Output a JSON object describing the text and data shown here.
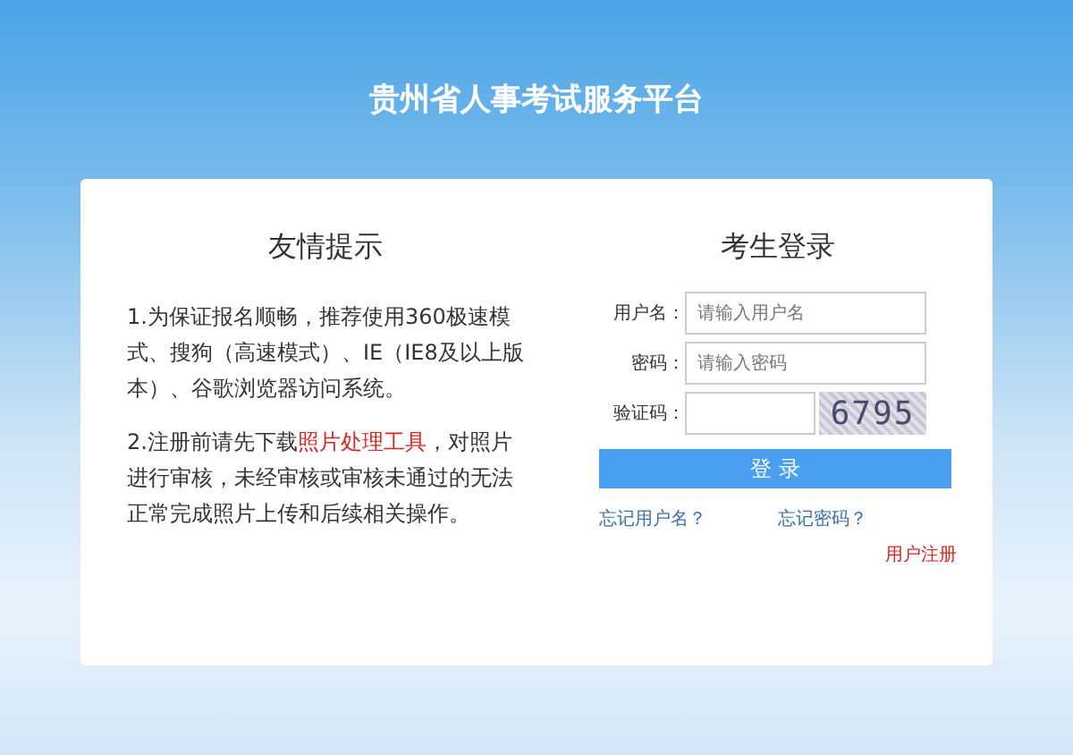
{
  "header": {
    "title": "贵州省人事考试服务平台"
  },
  "notice": {
    "title": "友情提示",
    "items": [
      {
        "before": "1.为保证报名顺畅，推荐使用360极速模式、搜狗（高速模式）、IE（IE8及以上版本）、谷歌浏览器访问系统。"
      },
      {
        "before": "2.注册前请先下载",
        "link": "照片处理工具",
        "after": "，对照片进行审核，未经审核或审核未通过的无法正常完成照片上传和后续相关操作。"
      }
    ]
  },
  "login": {
    "title": "考生登录",
    "fields": [
      {
        "kind": "text",
        "label": "用户名：",
        "placeholder": "请输入用户名"
      },
      {
        "kind": "text",
        "label": "密码：",
        "placeholder": "请输入密码"
      },
      {
        "kind": "captcha",
        "label": "验证码：",
        "captcha": "6795"
      }
    ],
    "button": "登 录",
    "forgot_username": "忘记用户名？",
    "forgot_password": "忘记密码？",
    "register": "用户注册"
  }
}
